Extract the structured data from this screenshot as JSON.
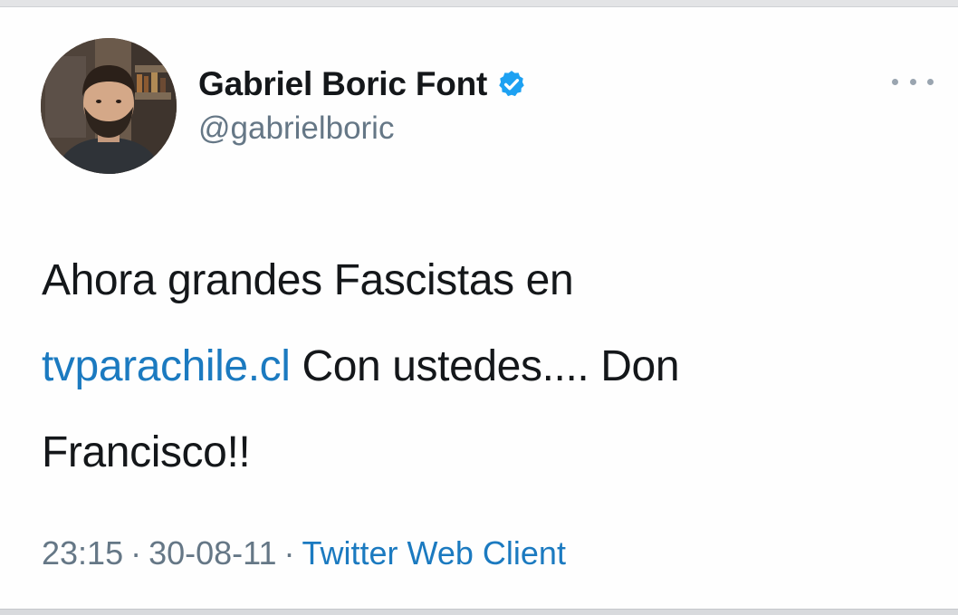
{
  "tweet": {
    "author": {
      "display_name": "Gabriel Boric Font",
      "handle": "@gabrielboric",
      "verified": true
    },
    "text_line1": "Ahora grandes Fascistas en",
    "link": "tvparachile.cl",
    "text_line2_rest": " Con ustedes.... Don",
    "text_line3": "Francisco!!",
    "time": "23:15",
    "separator": "·",
    "date": "30-08-11",
    "client": "Twitter Web Client",
    "more_icon": "more-horizontal-icon"
  },
  "colors": {
    "text": "#14171a",
    "secondary": "#657786",
    "link": "#1b7ac0",
    "verified_badge": "#1da1f2"
  }
}
